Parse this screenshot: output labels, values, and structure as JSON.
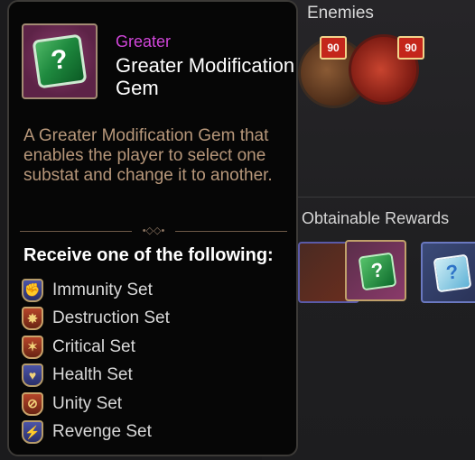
{
  "background": {
    "enemies_title": "Enemies",
    "enemy_levels": [
      "90",
      "90"
    ],
    "rewards_title": "Obtainable Rewards",
    "reward_glyphs": [
      "?",
      "?"
    ]
  },
  "tooltip": {
    "grade": "Greater",
    "item_name": "Greater Modification Gem",
    "gem_glyph": "?",
    "description": "A Greater Modification Gem that enables the player to select one substat and change it to another.",
    "ornament": "•◇◇•",
    "receive_heading": "Receive one of the following:",
    "sets": [
      {
        "label": "Immunity Set",
        "icon": "immunity-icon",
        "glyph": "✊",
        "style": "blue"
      },
      {
        "label": "Destruction Set",
        "icon": "destruction-icon",
        "glyph": "✸",
        "style": "red"
      },
      {
        "label": "Critical Set",
        "icon": "critical-icon",
        "glyph": "✶",
        "style": "red"
      },
      {
        "label": "Health Set",
        "icon": "health-icon",
        "glyph": "♥",
        "style": "blue"
      },
      {
        "label": "Unity Set",
        "icon": "unity-icon",
        "glyph": "⊘",
        "style": "red"
      },
      {
        "label": "Revenge Set",
        "icon": "revenge-icon",
        "glyph": "⚡",
        "style": "blue"
      }
    ]
  },
  "colors": {
    "grade_purple": "#d046d9",
    "description_tan": "#b7977a",
    "level_badge_red": "#c4261b"
  }
}
